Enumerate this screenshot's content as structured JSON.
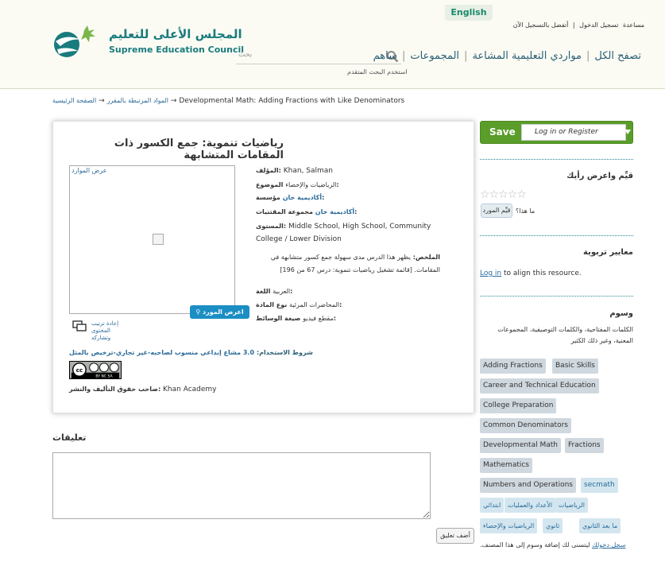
{
  "header": {
    "language_btn": "English",
    "top_links": [
      "مساعدة",
      "تسجيل الدخول",
      "|",
      "أتفضل بالتسجيل الآن"
    ],
    "logo_ar": "المجلس الأعلى للتعليم",
    "logo_en": "Supreme Education Council",
    "search_placeholder": "بحث",
    "advanced_search": "استخدم البحث المتقدم",
    "nav": [
      "تصفح الكل",
      "مواردي التعليمية المشاعة",
      "المجموعات",
      "ساهم"
    ],
    "colors": {
      "brand": "#1a7b7d",
      "nav": "#2b5f76"
    }
  },
  "breadcrumb": {
    "home": "الصفحة الرئيسية",
    "arrow": "→",
    "section": "المواد المرتبطة بالمقرر",
    "current": "Developmental Math: Adding Fractions with Like Denominators"
  },
  "resource": {
    "title": "رياضيات تنموية: جمع الكسور ذات المقامات المتشابهة",
    "thumb_caption": "عرض الموارد",
    "view_button": "اعرض المورد",
    "remix_label": "إعادة ترتيب المحتوى وتشاركه",
    "license_prefix": "شروط الاستخدام:",
    "license_version": "3.0",
    "license_text": "مشاع إبداعي منسوب لصاحبه-غير تجاري-ترخيص بالمثل",
    "cc_badge": "BY NC SA",
    "holder_label": "صاحب حقوق التأليف والنشر:",
    "holder": "Khan Academy",
    "meta": {
      "author_label": "المؤلف:",
      "author": "Khan, Salman",
      "subject_label": "الموضوع:",
      "subject": "الرياضيات والإحصاء",
      "institution_label": "مؤسسة:",
      "institution": "أكاديمية خان",
      "collection_label": "مجموعة المقتنيات:",
      "collection": "أكاديمية خان",
      "level_label": "المستوى:",
      "level": "Middle School, High School, Community College / Lower Division",
      "summary_label": "الملخص:",
      "summary": "يظهر هذا الدرس مدى سهولة جمع كسور متشابهة في المقامات. [قائمة تشغيل رياضيات تنموية: درس 67 من 196]",
      "language_label": "اللغة:",
      "language": "العربية",
      "material_label": "نوع المادة:",
      "material": "المحاضرات المرئية",
      "media_label": "صيغة الوسائط:",
      "media": "مقطع فيديو"
    }
  },
  "comments": {
    "title": "تعليقات",
    "add_button": "أضف تعليق"
  },
  "sidebar": {
    "save": "Save",
    "login_register": "Log in or Register",
    "rate_title": "قيِّم واعرض رأيك",
    "stars": "☆☆☆☆☆",
    "rating": 0,
    "what_is": "ما هذا؟",
    "rate_button": "قيِّم المورد",
    "standards_title": "معايير تربوية",
    "align_link": "Log in",
    "align_text": "to align this resource.",
    "tags_title": "وسوم",
    "tags_desc": "الكلمات المفتاحية، والكلمات التوصيفية، المجموعات المعنية، وغير ذلك الكثير",
    "tags": [
      "Adding Fractions",
      "Basic Skills",
      "Career and Technical Education",
      "College Preparation",
      "Common Denominators",
      "Developmental Math",
      "Fractions",
      "Mathematics",
      "Numbers and Operations",
      "secmath",
      "الرياضيات",
      "الأعداد والعمليات",
      "ابتدائي",
      "ما بعد الثانوي",
      "ثانوي",
      "الرياضيات والإحصاء"
    ],
    "tags_login_link": "سجل دخولك",
    "tags_login_text": "ليتسنى لك إضافة وسوم إلى هذا المصنف."
  }
}
